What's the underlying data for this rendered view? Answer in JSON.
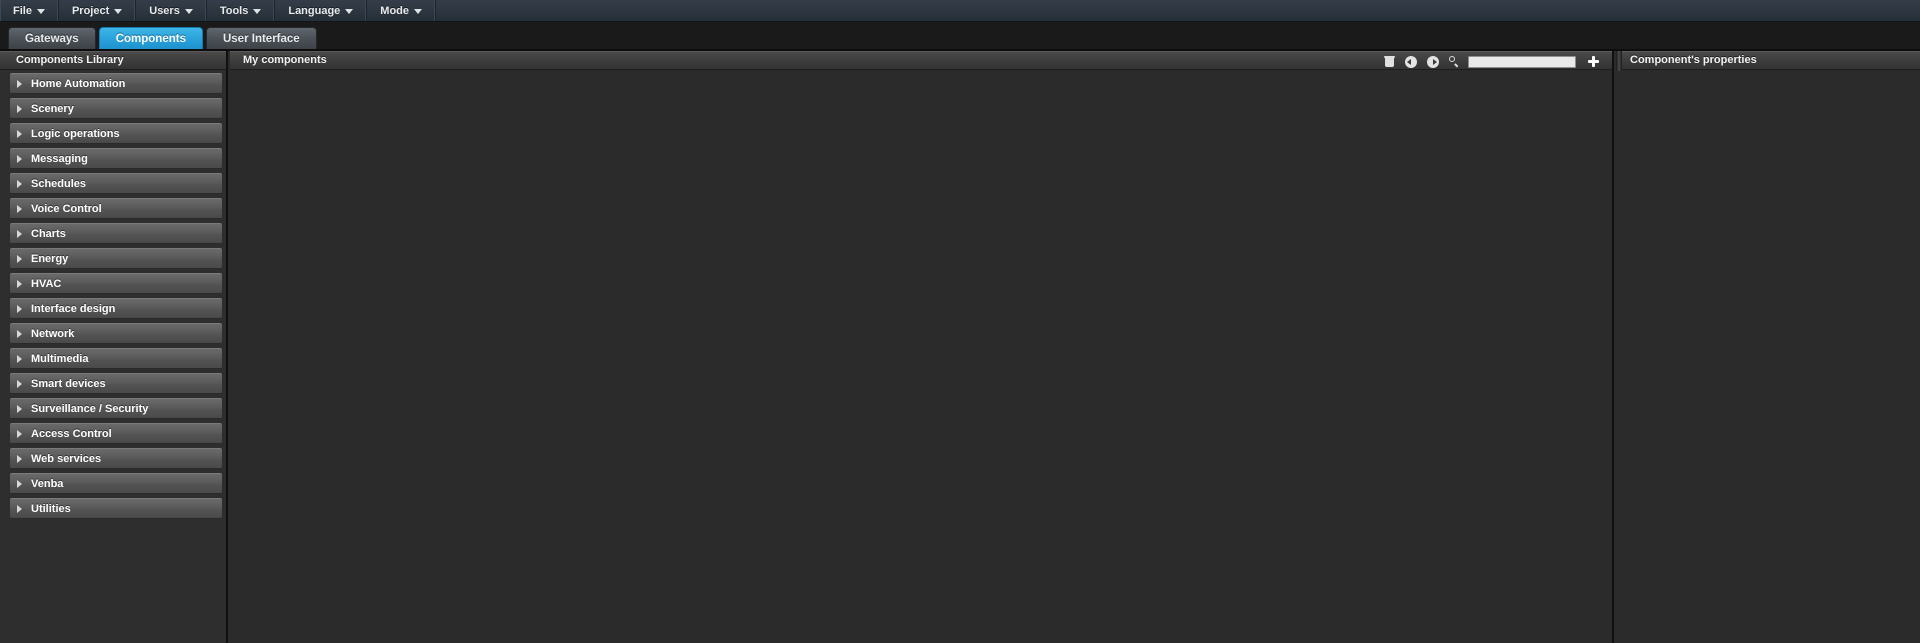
{
  "menubar": {
    "items": [
      {
        "label": "File",
        "icon": "chevron-down-icon"
      },
      {
        "label": "Project",
        "icon": "chevron-down-icon"
      },
      {
        "label": "Users",
        "icon": "chevron-down-icon"
      },
      {
        "label": "Tools",
        "icon": "chevron-down-icon"
      },
      {
        "label": "Language",
        "icon": "chevron-down-icon"
      },
      {
        "label": "Mode",
        "icon": "chevron-down-icon"
      }
    ]
  },
  "tabs": [
    {
      "label": "Gateways",
      "active": false
    },
    {
      "label": "Components",
      "active": true
    },
    {
      "label": "User Interface",
      "active": false
    }
  ],
  "sidebar": {
    "title": "Components Library",
    "items": [
      {
        "label": "Home Automation",
        "icon": "chevron-right-icon",
        "expanded": false
      },
      {
        "label": "Scenery",
        "icon": "chevron-right-icon",
        "expanded": false
      },
      {
        "label": "Logic operations",
        "icon": "chevron-right-icon",
        "expanded": false
      },
      {
        "label": "Messaging",
        "icon": "chevron-right-icon",
        "expanded": false
      },
      {
        "label": "Schedules",
        "icon": "chevron-right-icon",
        "expanded": false
      },
      {
        "label": "Voice Control",
        "icon": "chevron-right-icon",
        "expanded": false
      },
      {
        "label": "Charts",
        "icon": "chevron-right-icon",
        "expanded": false
      },
      {
        "label": "Energy",
        "icon": "chevron-right-icon",
        "expanded": false
      },
      {
        "label": "HVAC",
        "icon": "chevron-right-icon",
        "expanded": false
      },
      {
        "label": "Interface design",
        "icon": "chevron-right-icon",
        "expanded": false
      },
      {
        "label": "Network",
        "icon": "chevron-right-icon",
        "expanded": false
      },
      {
        "label": "Multimedia",
        "icon": "chevron-right-icon",
        "expanded": false
      },
      {
        "label": "Smart devices",
        "icon": "chevron-right-icon",
        "expanded": false
      },
      {
        "label": "Surveillance / Security",
        "icon": "chevron-right-icon",
        "expanded": false
      },
      {
        "label": "Access Control",
        "icon": "chevron-right-icon",
        "expanded": false
      },
      {
        "label": "Web services",
        "icon": "chevron-right-icon",
        "expanded": false
      },
      {
        "label": "Venba",
        "icon": "chevron-right-icon",
        "expanded": false
      },
      {
        "label": "Utilities",
        "icon": "chevron-right-icon",
        "expanded": false
      }
    ]
  },
  "center": {
    "title": "My components",
    "toolbar": {
      "delete_icon": "trash-icon",
      "back_icon": "circle-arrow-left-icon",
      "forward_icon": "circle-arrow-right-icon",
      "search_icon": "search-icon",
      "add_icon": "plus-icon"
    },
    "search": {
      "value": "",
      "placeholder": ""
    },
    "items": []
  },
  "right": {
    "title": "Component's properties",
    "items": []
  },
  "colors": {
    "accent": "#2aa3dd",
    "menubar_bg": "#2e3741",
    "panel_bg": "#2b2b2b",
    "row_bg": "#5c5c5c",
    "text": "#ffffff"
  }
}
